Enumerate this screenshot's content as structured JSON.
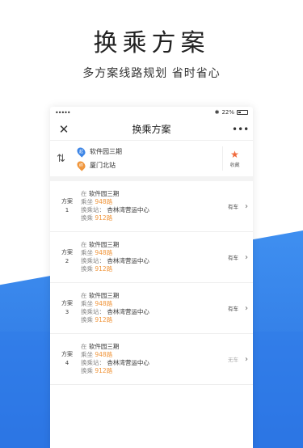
{
  "hero": {
    "title": "换乘方案",
    "subtitle": "多方案线路规划  省时省心"
  },
  "status_bar": {
    "signal": "•••••",
    "battery": "22%"
  },
  "navbar": {
    "title": "换乘方案",
    "more": "•••"
  },
  "route": {
    "from": "软件园三期",
    "to": "厦门北站",
    "from_marker": "起",
    "to_marker": "终",
    "favorite_label": "收藏"
  },
  "plans": [
    {
      "label_line1": "方案",
      "label_line2": "1",
      "at_prefix": "在",
      "at_stop": "软件园三期",
      "ride_prefix": "乘坐",
      "ride_route": "948路",
      "transfer_prefix": "换乘站：",
      "transfer_stop": "杏林湾营运中心",
      "transfer_ride_prefix": "换乘",
      "transfer_route": "912路",
      "status": "有车"
    },
    {
      "label_line1": "方案",
      "label_line2": "2",
      "at_prefix": "在",
      "at_stop": "软件园三期",
      "ride_prefix": "乘坐",
      "ride_route": "948路",
      "transfer_prefix": "换乘站：",
      "transfer_stop": "杏林湾营运中心",
      "transfer_ride_prefix": "换乘",
      "transfer_route": "912路",
      "status": "有车"
    },
    {
      "label_line1": "方案",
      "label_line2": "3",
      "at_prefix": "在",
      "at_stop": "软件园三期",
      "ride_prefix": "乘坐",
      "ride_route": "948路",
      "transfer_prefix": "换乘站：",
      "transfer_stop": "杏林湾营运中心",
      "transfer_ride_prefix": "换乘",
      "transfer_route": "912路",
      "status": "有车"
    },
    {
      "label_line1": "方案",
      "label_line2": "4",
      "at_prefix": "在",
      "at_stop": "软件园三期",
      "ride_prefix": "乘坐",
      "ride_route": "948路",
      "transfer_prefix": "换乘站：",
      "transfer_stop": "杏林湾营运中心",
      "transfer_ride_prefix": "换乘",
      "transfer_route": "912路",
      "status": "无车"
    }
  ],
  "icons": {
    "close": "close-icon",
    "more": "more-icon",
    "swap": "swap-icon",
    "star": "star-icon",
    "chevron": "chevron-right-icon"
  },
  "colors": {
    "accent_orange": "#f0963c",
    "blue": "#3d85e6",
    "star": "#f06a3c"
  }
}
